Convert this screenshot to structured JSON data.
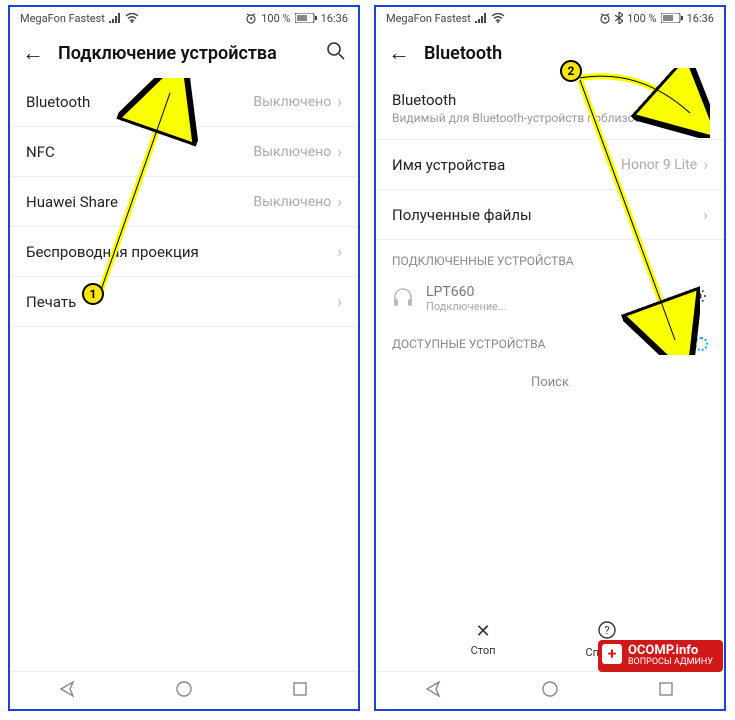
{
  "statusbar": {
    "carrier": "MegaFon Fastest",
    "battery_pct": "100 %",
    "time": "16:36"
  },
  "screen_left": {
    "title": "Подключение устройства",
    "rows": [
      {
        "label": "Bluetooth",
        "value": "Выключено"
      },
      {
        "label": "NFC",
        "value": "Выключено"
      },
      {
        "label": "Huawei Share",
        "value": "Выключено"
      },
      {
        "label": "Беспроводная проекция",
        "value": ""
      },
      {
        "label": "Печать",
        "value": ""
      }
    ]
  },
  "screen_right": {
    "title": "Bluetooth",
    "bt_row": {
      "label": "Bluetooth",
      "sub": "Видимый для Bluetooth-устройств поблизости",
      "on": true
    },
    "name_row": {
      "label": "Имя устройства",
      "value": "Honor 9 Lite"
    },
    "files_row": {
      "label": "Полученные файлы"
    },
    "connected_header": "ПОДКЛЮЧЕННЫЕ УСТРОЙСТВА",
    "device": {
      "name": "LPT660",
      "status": "Подключение..."
    },
    "available_header": "ДОСТУПНЫЕ УСТРОЙСТВА",
    "searching": "Поиск",
    "actions": {
      "stop": "Стоп",
      "help": "Справка"
    }
  },
  "badges": {
    "b1": "1",
    "b2": "2"
  },
  "watermark": {
    "line1": "OCOMP.info",
    "line2": "ВОПРОСЫ АДМИНУ"
  }
}
